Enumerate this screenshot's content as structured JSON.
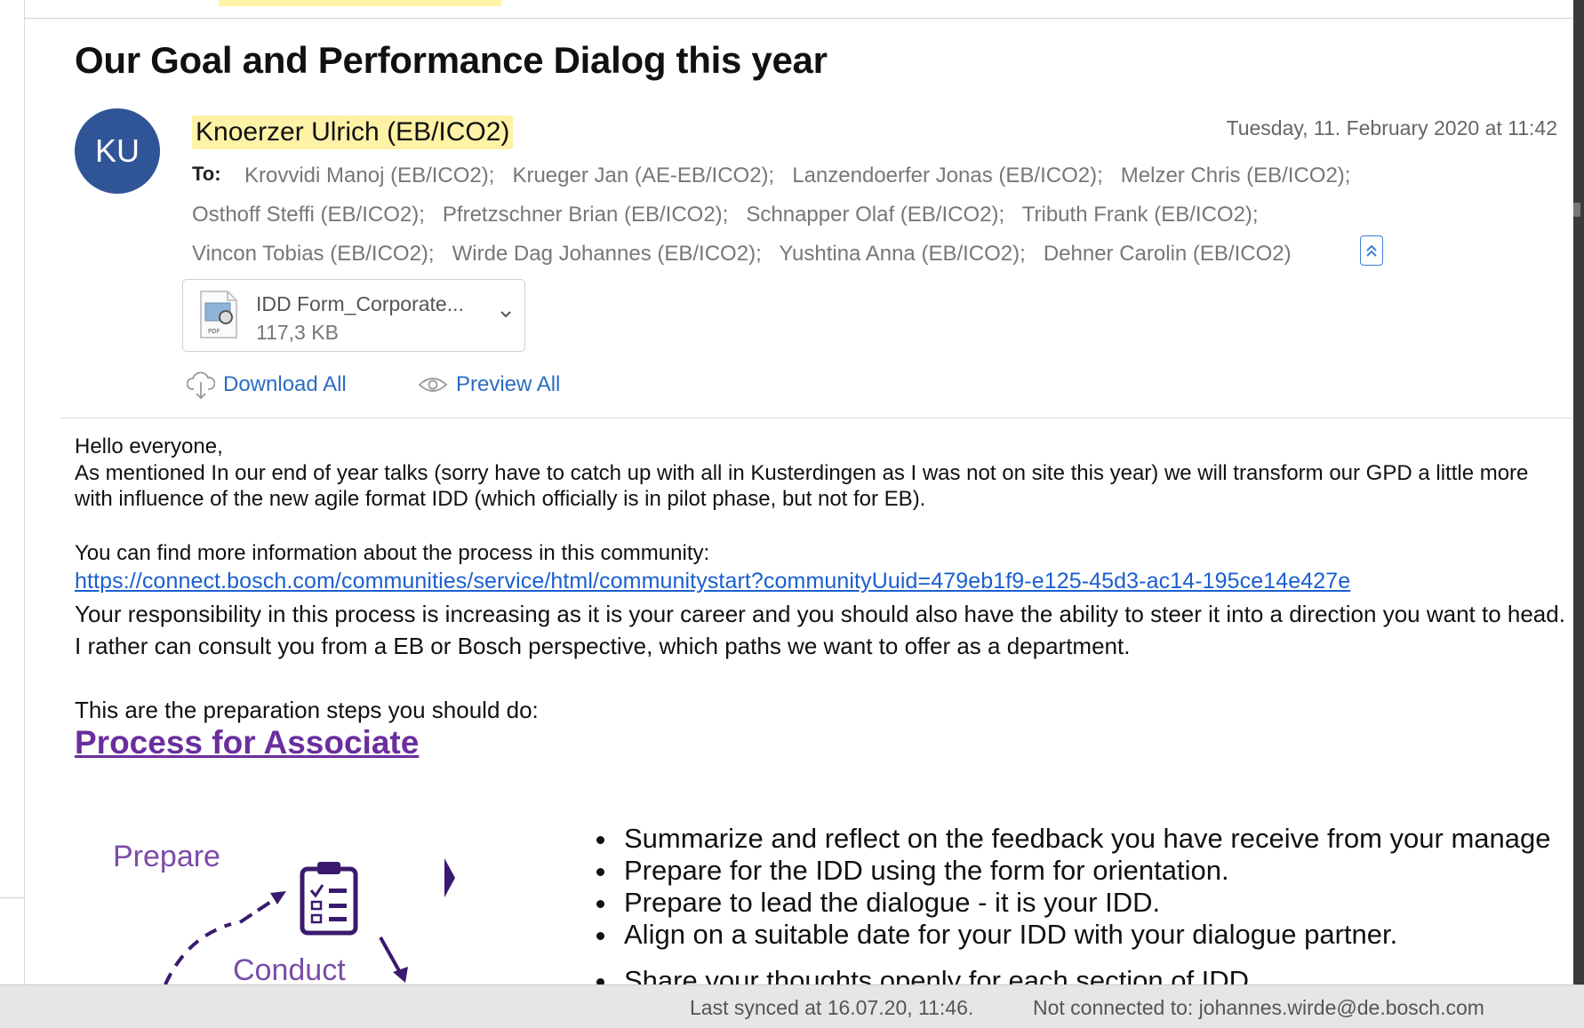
{
  "email": {
    "subject": "Our Goal and Performance Dialog this year",
    "sender_initials": "KU",
    "sender": "Knoerzer Ulrich (EB/ICO2)",
    "date": "Tuesday, 11. February 2020 at 11:42",
    "to_label": "To:",
    "recipients": [
      "Krovvidi Manoj (EB/ICO2);",
      "Krueger Jan (AE-EB/ICO2);",
      "Lanzendoerfer Jonas (EB/ICO2);",
      "Melzer Chris (EB/ICO2);",
      "Osthoff Steffi (EB/ICO2);",
      "Pfretzschner Brian (EB/ICO2);",
      "Schnapper Olaf (EB/ICO2);",
      "Tributh Frank (EB/ICO2);",
      "Vincon Tobias (EB/ICO2);",
      "Wirde Dag Johannes (EB/ICO2);",
      "Yushtina Anna (EB/ICO2);",
      "Dehner Carolin (EB/ICO2)"
    ],
    "collapse_icon": "double-chevron-up-icon"
  },
  "attachment": {
    "name": "IDD Form_Corporate...",
    "size": "117,3 KB",
    "icon": "pdf-file-icon",
    "icon_label": "PDF"
  },
  "actions": {
    "download_all": "Download All",
    "preview_all": "Preview All"
  },
  "body": {
    "greeting": "Hello everyone,",
    "para1": "As mentioned In our end of year talks (sorry have to catch up with all in Kusterdingen as I was not on site this year) we will transform our GPD a little more with influence of the new agile format IDD (which officially is in pilot phase, but not for EB).",
    "para2": "You can find more information about the process in this community:",
    "link": "https://connect.bosch.com/communities/service/html/communitystart?communityUuid=479eb1f9-e125-45d3-ac14-195ce14e427e",
    "para3": "Your responsibility in this process is increasing as it is your career and you should also have the ability to steer it into a direction you want to head. I rather can consult you from a EB or Bosch perspective, which paths we want to offer as a department.",
    "para4": "This are the preparation steps you should do:",
    "process_title": "Process for Associate",
    "diagram_labels": {
      "prepare": "Prepare",
      "conduct": "Conduct"
    },
    "bullets": [
      "Summarize and reflect on the feedback you have receive from your manage",
      "Prepare for the IDD using the form for orientation.",
      "Prepare to lead the dialogue - it is your IDD.",
      "Align on a suitable date for your IDD with your dialogue partner.",
      "Share your thoughts openly for each section of IDD"
    ]
  },
  "status": {
    "synced": "Last synced at 16.07.20, 11:46.",
    "connection": "Not connected to: johannes.wirde@de.bosch.com"
  },
  "colors": {
    "avatar": "#2f5597",
    "sender_highlight": "#fdf2a6",
    "link": "#1a5fd0",
    "accent_purple": "#6a2e9e"
  }
}
